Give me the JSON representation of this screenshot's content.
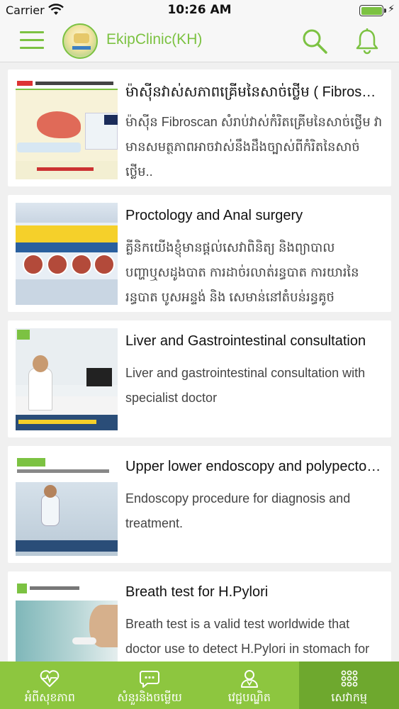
{
  "status_bar": {
    "carrier": "Carrier",
    "time": "10:26 AM"
  },
  "header": {
    "title": "EkipClinic(KH)",
    "icons": [
      "menu-icon",
      "app-logo",
      "search-icon",
      "bell-icon"
    ]
  },
  "colors": {
    "accent": "#7cc242",
    "tabbar": "#8dc63f",
    "tab_active": "#6ea82e"
  },
  "items": [
    {
      "title": "ម៉ាស៊ីនវាស់សភាពគ្រើមនៃសាច់ថ្លើម ( Fibroscan )",
      "description": "ម៉ាស៊ីន Fibroscan សំរាប់វាស់កំរិតគ្រើមនៃសាច់ថ្លើម វាមានសមត្ថភាពអាចវាស់នឹងដឹងច្បាស់ពីកំរិតនៃសាច់ថ្លើម.."
    },
    {
      "title": "Proctology and Anal surgery",
      "description": "គ្លីនិកយើងខ្ញុំមានផ្តល់សេវាពិនិត្យ និងព្យាបាលបញ្ហាឬសដូងបាត ការដាច់រលាត់រន្ធបាត ការយារនៃរន្ធបាត បូសអន្ទង់ និង សេមាន់នៅតំបន់រន្ធគូថ"
    },
    {
      "title": "Liver and Gastrointestinal consultation",
      "description": "Liver and gastrointestinal consultation with specialist doctor"
    },
    {
      "title": "Upper  lower endoscopy and polypectomy",
      "description": "Endoscopy procedure for diagnosis and treatment."
    },
    {
      "title": "Breath test for H.Pylori",
      "description": "Breath test is a valid test worldwide that doctor use to detect H.Pylori in stomach for"
    }
  ],
  "tabs": [
    {
      "label": "អំពីសុខភាព",
      "icon": "heart-pulse-icon",
      "active": false
    },
    {
      "label": "សំនួរនិងចម្លើយ",
      "icon": "chat-bubble-icon",
      "active": false
    },
    {
      "label": "វេជ្ជបណ្ឌិត",
      "icon": "doctors-icon",
      "active": false
    },
    {
      "label": "សេវាកម្ម",
      "icon": "grid-dots-icon",
      "active": true
    }
  ]
}
